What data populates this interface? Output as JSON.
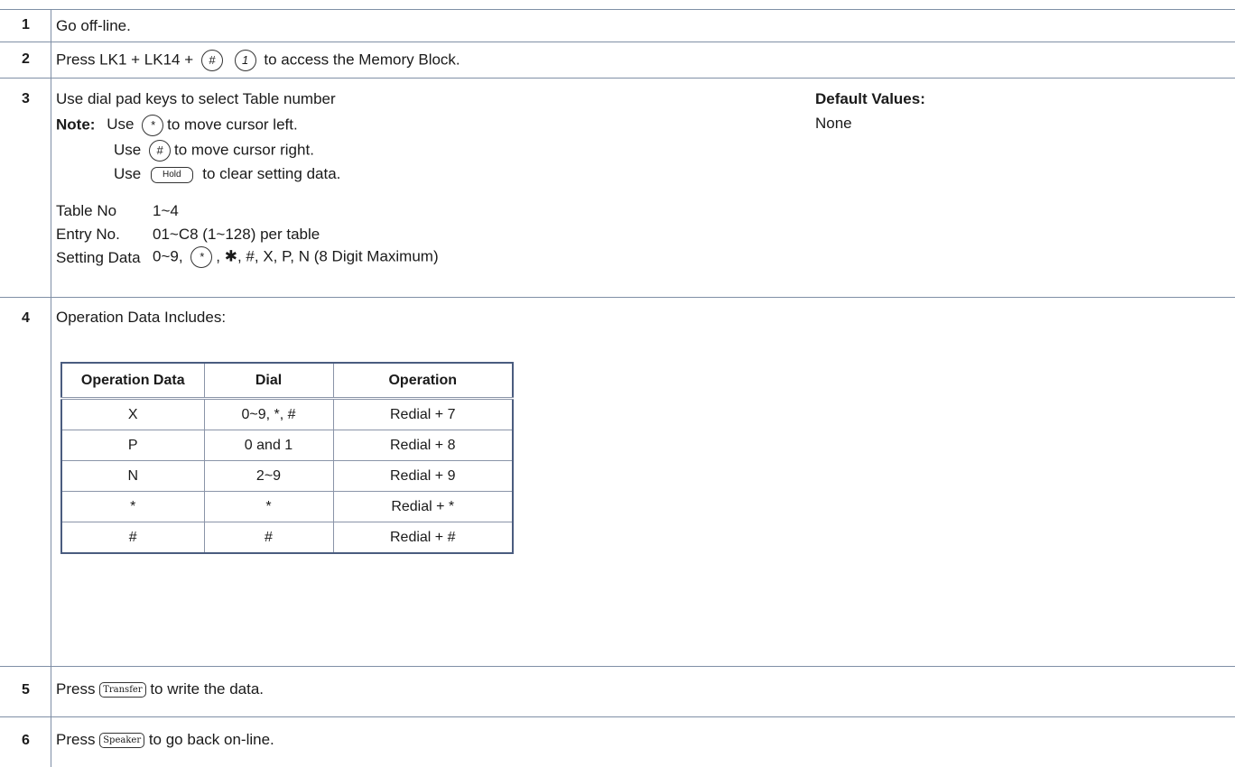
{
  "steps": [
    {
      "num": "1",
      "text": "Go off-line."
    },
    {
      "num": "2",
      "prefix": "Press LK1 + LK14 +",
      "keys": [
        "#",
        "1"
      ],
      "suffix": "to access the Memory Block."
    },
    {
      "num": "3",
      "intro": "Use dial pad keys to select Table number",
      "note_label": "Note:",
      "note_lines": [
        {
          "pre": "Use",
          "key": "*",
          "post": "to move cursor left."
        },
        {
          "pre": "Use",
          "key": "#",
          "post": "to move cursor right."
        },
        {
          "pre": "Use",
          "key": "Hold",
          "post": "to clear setting data."
        }
      ],
      "params": [
        {
          "label": "Table No",
          "value": "1~4"
        },
        {
          "label": "Entry No.",
          "value": "01~C8 (1~128) per table"
        },
        {
          "label": "Setting Data",
          "value_pre": "0~9,",
          "key": "*",
          "value_post": ", ✱, #, X, P, N (8 Digit Maximum)"
        }
      ],
      "default_title": "Default Values:",
      "default_value": "None"
    },
    {
      "num": "4",
      "text": "Operation Data Includes:",
      "table": {
        "headers": [
          "Operation Data",
          "Dial",
          "Operation"
        ],
        "rows": [
          [
            "X",
            "0~9, *, #",
            "Redial + 7"
          ],
          [
            "P",
            "0 and 1",
            "Redial + 8"
          ],
          [
            "N",
            "2~9",
            "Redial + 9"
          ],
          [
            "*",
            "*",
            "Redial + *"
          ],
          [
            "#",
            "#",
            "Redial + #"
          ]
        ]
      }
    },
    {
      "num": "5",
      "prefix": "Press",
      "key": "Transfer",
      "suffix": "to write the data."
    },
    {
      "num": "6",
      "prefix": "Press",
      "key": "Speaker",
      "suffix": "to go back on-line."
    }
  ]
}
